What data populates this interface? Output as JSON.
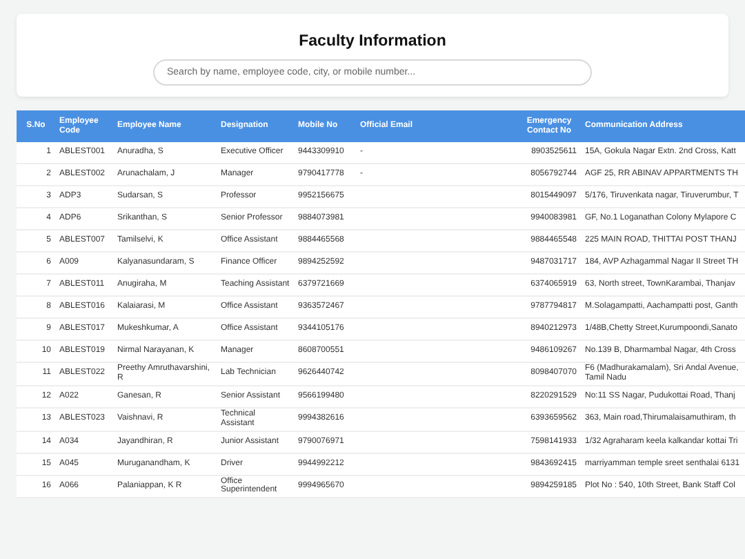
{
  "header": {
    "title": "Faculty Information",
    "search": {
      "placeholder": "Search by name, employee code, city, or mobile number..."
    }
  },
  "table": {
    "columns": [
      "S.No",
      "Employee Code",
      "Employee Name",
      "Designation",
      "Mobile No",
      "Official Email",
      "Emergency Contact No",
      "Communication Address"
    ],
    "rows": [
      [
        "1",
        "ABLEST001",
        "Anuradha, S",
        "Executive Officer",
        "9443309910",
        "-",
        "8903525611",
        "15A, Gokula Nagar Extn. 2nd Cross, Katt"
      ],
      [
        "2",
        "ABLEST002",
        "Arunachalam, J",
        "Manager",
        "9790417778",
        "-",
        "8056792744",
        "AGF 25, RR ABINAV APPARTMENTS TH"
      ],
      [
        "3",
        "ADP3",
        "Sudarsan, S",
        "Professor",
        "9952156675",
        "",
        "8015449097",
        "5/176, Tiruvenkata nagar, Tiruverumbur, T"
      ],
      [
        "4",
        "ADP6",
        "Srikanthan, S",
        "Senior Professor",
        "9884073981",
        "",
        "9940083981",
        "GF, No.1 Loganathan Colony Mylapore C"
      ],
      [
        "5",
        "ABLEST007",
        "Tamilselvi, K",
        "Office Assistant",
        "9884465568",
        "",
        "9884465548",
        "225 MAIN ROAD, THITTAI POST THANJ"
      ],
      [
        "6",
        "A009",
        "Kalyanasundaram, S",
        "Finance Officer",
        "9894252592",
        "",
        "9487031717",
        "184, AVP Azhagammal Nagar II Street TH"
      ],
      [
        "7",
        "ABLEST011",
        "Anugiraha, M",
        "Teaching Assistant",
        "6379721669",
        "",
        "6374065919",
        "63, North street, TownKarambai, Thanjav"
      ],
      [
        "8",
        "ABLEST016",
        "Kalaiarasi, M",
        "Office Assistant",
        "9363572467",
        "",
        "9787794817",
        "M.Solagampatti, Aachampatti post, Ganth"
      ],
      [
        "9",
        "ABLEST017",
        "Mukeshkumar, A",
        "Office Assistant",
        "9344105176",
        "",
        "8940212973",
        "1/48B,Chetty Street,Kurumpoondi,Sanato"
      ],
      [
        "10",
        "ABLEST019",
        "Nirmal Narayanan, K",
        "Manager",
        "8608700551",
        "",
        "9486109267",
        "No.139 B, Dharmambal Nagar, 4th Cross"
      ],
      [
        "11",
        "ABLEST022",
        "Preethy Amruthavarshini, R",
        "Lab Technician",
        "9626440742",
        "",
        "8098407070",
        "F6 (Madhurakamalam), Sri Andal Avenue,\nTamil Nadu"
      ],
      [
        "12",
        "A022",
        "Ganesan, R",
        "Senior Assistant",
        "9566199480",
        "",
        "8220291529",
        "No:11 SS Nagar, Pudukottai Road, Thanj"
      ],
      [
        "13",
        "ABLEST023",
        "Vaishnavi, R",
        "Technical Assistant",
        "9994382616",
        "",
        "6393659562",
        "363, Main road,Thirumalaisamuthiram, th"
      ],
      [
        "14",
        "A034",
        "Jayandhiran, R",
        "Junior Assistant",
        "9790076971",
        "",
        "7598141933",
        "1/32 Agraharam keela kalkandar kottai Tri"
      ],
      [
        "15",
        "A045",
        "Muruganandham, K",
        "Driver",
        "9944992212",
        "",
        "9843692415",
        "marriyamman temple sreet senthalai 6131"
      ],
      [
        "16",
        "A066",
        "Palaniappan, K R",
        "Office Superintendent",
        "9994965670",
        "",
        "9894259185",
        "Plot No : 540, 10th Street, Bank Staff Col"
      ]
    ]
  }
}
